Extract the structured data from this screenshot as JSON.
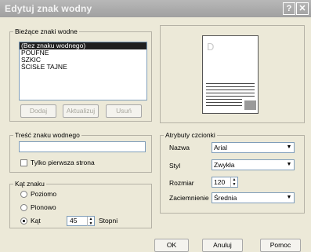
{
  "window": {
    "title": "Edytuj znak wodny",
    "help_glyph": "?",
    "close_glyph": "✕"
  },
  "current": {
    "group_label": "Bieżące znaki wodne",
    "items": [
      "(Bez znaku wodnego)",
      "POUFNE",
      "SZKIC",
      "ŚCISŁE TAJNE"
    ],
    "selected_index": 0,
    "add_label": "Dodaj",
    "update_label": "Aktualizuj",
    "delete_label": "Usuń"
  },
  "content": {
    "group_label": "Treść znaku wodnego",
    "text_value": "",
    "first_page_only_label": "Tylko pierwsza strona",
    "first_page_only_checked": false
  },
  "angle": {
    "group_label": "Kąt znaku",
    "horizontal_label": "Poziomo",
    "vertical_label": "Pionowo",
    "angle_label": "Kąt",
    "angle_value": "45",
    "unit_label": "Stopni",
    "selected": "angle"
  },
  "font": {
    "group_label": "Atrybuty czcionki",
    "name_label": "Nazwa",
    "name_value": "Arial",
    "style_label": "Styl",
    "style_value": "Zwykła",
    "size_label": "Rozmiar",
    "size_value": "120",
    "shade_label": "Zaciemnienie",
    "shade_value": "Średnia"
  },
  "preview": {
    "watermark_letter": "D"
  },
  "footer": {
    "ok_label": "OK",
    "cancel_label": "Anuluj",
    "help_label": "Pomoc"
  }
}
